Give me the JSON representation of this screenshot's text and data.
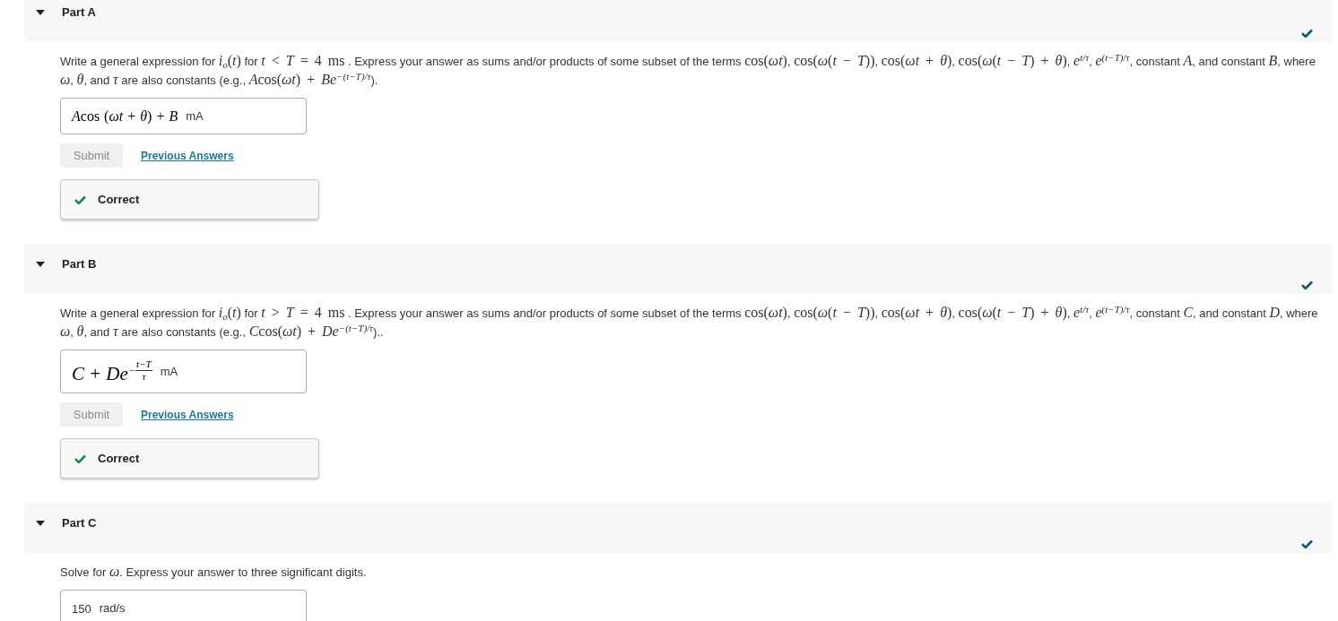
{
  "parts": [
    {
      "label": "Part A",
      "expanded": true,
      "completed": true,
      "prompt": [
        {
          "kind": "text",
          "s": "Write a general expression for "
        },
        {
          "kind": "math",
          "s": "*i*$_{o}$(*t*)"
        },
        {
          "kind": "text",
          "s": " for "
        },
        {
          "kind": "math",
          "s": "*t* < *T* = 4 ms"
        },
        {
          "kind": "text",
          "s": " . Express your answer as sums and/or products of some subset of the terms "
        },
        {
          "kind": "math",
          "s": "cos(*ωt*)"
        },
        {
          "kind": "text",
          "s": ", "
        },
        {
          "kind": "math",
          "s": "cos(*ω*(*t* − *T*))"
        },
        {
          "kind": "text",
          "s": ", "
        },
        {
          "kind": "math",
          "s": "cos(*ωt* + *θ*)"
        },
        {
          "kind": "text",
          "s": ", "
        },
        {
          "kind": "math",
          "s": "cos(*ω*(*t* − *T*) + *θ*)"
        },
        {
          "kind": "text",
          "s": ", "
        },
        {
          "kind": "math",
          "s": "*e*$^{t/τ}$"
        },
        {
          "kind": "text",
          "s": ", "
        },
        {
          "kind": "math",
          "s": "*e*$^{(t−T)/τ}$"
        },
        {
          "kind": "text",
          "s": ", constant "
        },
        {
          "kind": "math",
          "s": "*A*"
        },
        {
          "kind": "text",
          "s": ", and constant "
        },
        {
          "kind": "math",
          "s": "*B*"
        },
        {
          "kind": "text",
          "s": ", where "
        },
        {
          "kind": "math",
          "s": "*ω*"
        },
        {
          "kind": "text",
          "s": ", "
        },
        {
          "kind": "math",
          "s": "*θ*"
        },
        {
          "kind": "text",
          "s": ", and "
        },
        {
          "kind": "math",
          "s": "*τ*"
        },
        {
          "kind": "text",
          "s": " are also constants (e.g., "
        },
        {
          "kind": "math",
          "s": "*A*"
        },
        {
          "kind": "math",
          "s": "cos(*ωt*) + *Be*$^{−(t−T)/τ}$"
        },
        {
          "kind": "text",
          "s": ")."
        }
      ],
      "answer": {
        "value": [
          {
            "kind": "math",
            "s": "*A*"
          },
          {
            "kind": "math",
            "s": "cos (*ωt* + *θ*) + *B*"
          }
        ],
        "unit": "mA"
      },
      "submit": {
        "label": "Submit",
        "disabled": true
      },
      "previous_answers": "Previous Answers",
      "feedback": {
        "kind": "correct",
        "text": "Correct"
      }
    },
    {
      "label": "Part B",
      "expanded": true,
      "completed": true,
      "prompt": [
        {
          "kind": "text",
          "s": "Write a general expression for "
        },
        {
          "kind": "math",
          "s": "*i*$_{o}$(*t*)"
        },
        {
          "kind": "text",
          "s": " for "
        },
        {
          "kind": "math",
          "s": "*t* > *T* = 4 ms"
        },
        {
          "kind": "text",
          "s": " . Express your answer as sums and/or products of some subset of the terms "
        },
        {
          "kind": "math",
          "s": "cos(*ωt*)"
        },
        {
          "kind": "text",
          "s": ", "
        },
        {
          "kind": "math",
          "s": "cos(*ω*(*t* − *T*))"
        },
        {
          "kind": "text",
          "s": ", "
        },
        {
          "kind": "math",
          "s": "cos(*ωt* + *θ*)"
        },
        {
          "kind": "text",
          "s": ", "
        },
        {
          "kind": "math",
          "s": "cos(*ω*(*t* − *T*) + *θ*)"
        },
        {
          "kind": "text",
          "s": ", "
        },
        {
          "kind": "math",
          "s": "*e*$^{t/τ}$"
        },
        {
          "kind": "text",
          "s": ", "
        },
        {
          "kind": "math",
          "s": "*e*$^{(t−T)/τ}$"
        },
        {
          "kind": "text",
          "s": ", constant "
        },
        {
          "kind": "math",
          "s": "*C*"
        },
        {
          "kind": "text",
          "s": ", and constant "
        },
        {
          "kind": "math",
          "s": "*D*"
        },
        {
          "kind": "text",
          "s": ", where "
        },
        {
          "kind": "math",
          "s": "*ω*"
        },
        {
          "kind": "text",
          "s": ", "
        },
        {
          "kind": "math",
          "s": "*θ*"
        },
        {
          "kind": "text",
          "s": ", and "
        },
        {
          "kind": "math",
          "s": "*τ*"
        },
        {
          "kind": "text",
          "s": " are also constants (e.g., "
        },
        {
          "kind": "math",
          "s": "*C*"
        },
        {
          "kind": "math",
          "s": "cos(*ωt*) + *De*$^{−(t−T)/τ}$"
        },
        {
          "kind": "text",
          "s": ").."
        }
      ],
      "answer": {
        "value": [
          {
            "kind": "math",
            "s": "*C* + *De*"
          },
          {
            "kind": "frac_exponent",
            "sign": "−",
            "num": "t−T",
            "den": "τ"
          }
        ],
        "unit": "mA"
      },
      "submit": {
        "label": "Submit",
        "disabled": true
      },
      "previous_answers": "Previous Answers",
      "feedback": {
        "kind": "correct",
        "text": "Correct"
      }
    },
    {
      "label": "Part C",
      "expanded": true,
      "completed": true,
      "prompt": [
        {
          "kind": "text",
          "s": "Solve for "
        },
        {
          "kind": "math",
          "s": "*ω*"
        },
        {
          "kind": "text",
          "s": ". Express your answer to three significant digits."
        }
      ],
      "answer": {
        "value": [
          {
            "kind": "text",
            "s": "150"
          }
        ],
        "unit": "rad/s"
      }
    }
  ]
}
